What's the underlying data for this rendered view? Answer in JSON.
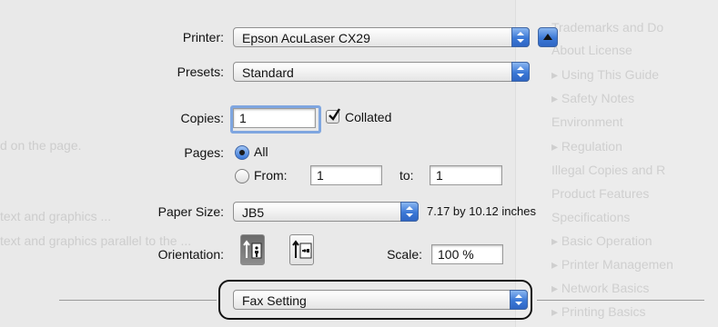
{
  "background": {
    "toc_items": [
      "Trademarks and Do",
      "About License",
      "▸ Using This Guide",
      "▸ Safety Notes",
      "Environment",
      "▸ Regulation",
      "Illegal Copies and R",
      "Product Features",
      "Specifications",
      "▸ Basic Operation",
      "▸ Printer Managemen",
      "▸ Network Basics",
      "▸ Printing Basics"
    ],
    "doc_lines": [
      "d on the page.",
      "text and graphics ...",
      "text and graphics parallel to the ..."
    ]
  },
  "printer": {
    "label": "Printer:",
    "value": "Epson AcuLaser CX29",
    "disclosure_icon": "disclosure-up-icon"
  },
  "presets": {
    "label": "Presets:",
    "value": "Standard"
  },
  "copies": {
    "label": "Copies:",
    "value": "1",
    "collated_label": "Collated",
    "collated_checked": true
  },
  "pages": {
    "label": "Pages:",
    "all_label": "All",
    "from_label": "From:",
    "from_value": "1",
    "to_label": "to:",
    "to_value": "1",
    "selected": "all"
  },
  "paper_size": {
    "label": "Paper Size:",
    "value": "JB5",
    "dimensions": "7.17 by 10.12 inches"
  },
  "orientation": {
    "label": "Orientation:",
    "options": [
      "portrait",
      "landscape"
    ],
    "selected": "portrait"
  },
  "scale": {
    "label": "Scale:",
    "value": "100 %"
  },
  "section_popup": {
    "value": "Fax Setting"
  },
  "colors": {
    "accent": "#3b78d6",
    "focus": "#7fa6e0"
  }
}
